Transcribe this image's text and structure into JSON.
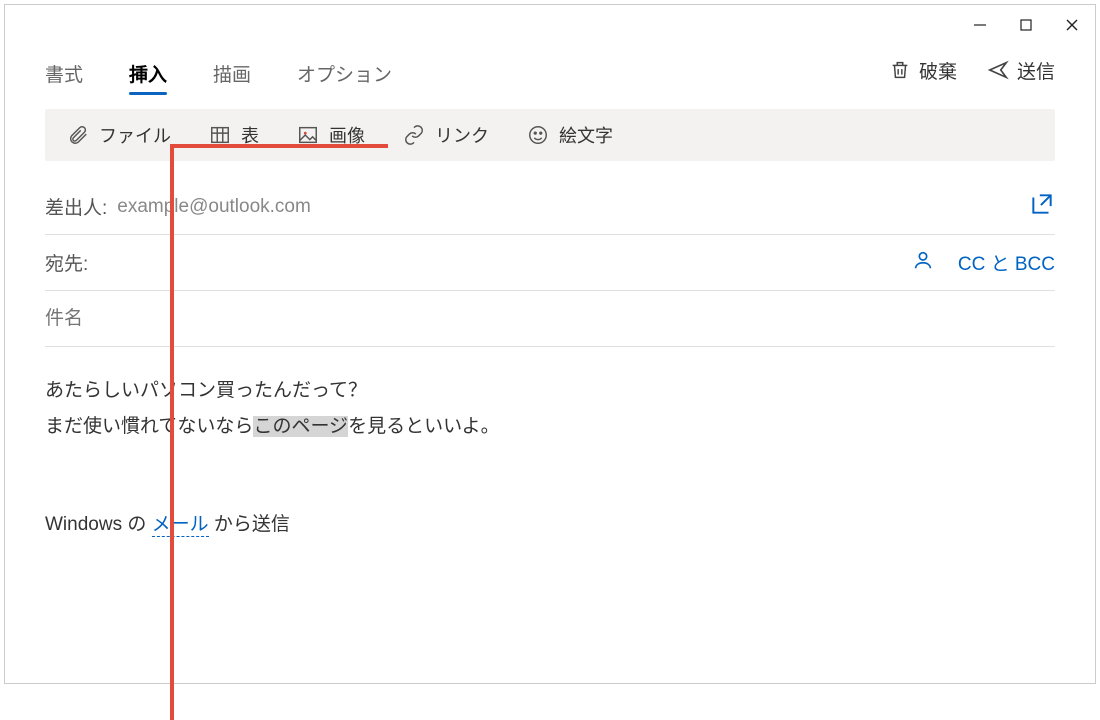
{
  "titlebar": {
    "minimize": "–",
    "maximize": "□",
    "close": "×"
  },
  "tabs": [
    "書式",
    "挿入",
    "描画",
    "オプション"
  ],
  "active_tab_index": 1,
  "top_actions": {
    "discard": "破棄",
    "send": "送信"
  },
  "insert_bar": {
    "file": "ファイル",
    "table": "表",
    "image": "画像",
    "link": "リンク",
    "emoji": "絵文字"
  },
  "fields": {
    "from_label": "差出人:",
    "from_email": "example@outlook.com",
    "to_label": "宛先:",
    "cc_bcc": "CC と BCC",
    "subject_placeholder": "件名"
  },
  "body": {
    "line1": "あたらしいパソコン買ったんだって？",
    "line2a": "まだ使い慣れてないなら",
    "line2_selected": "このページ",
    "line2b": "を見るといいよ。",
    "sig_before": "Windows の ",
    "sig_link": "メール",
    "sig_after": " から送信"
  }
}
